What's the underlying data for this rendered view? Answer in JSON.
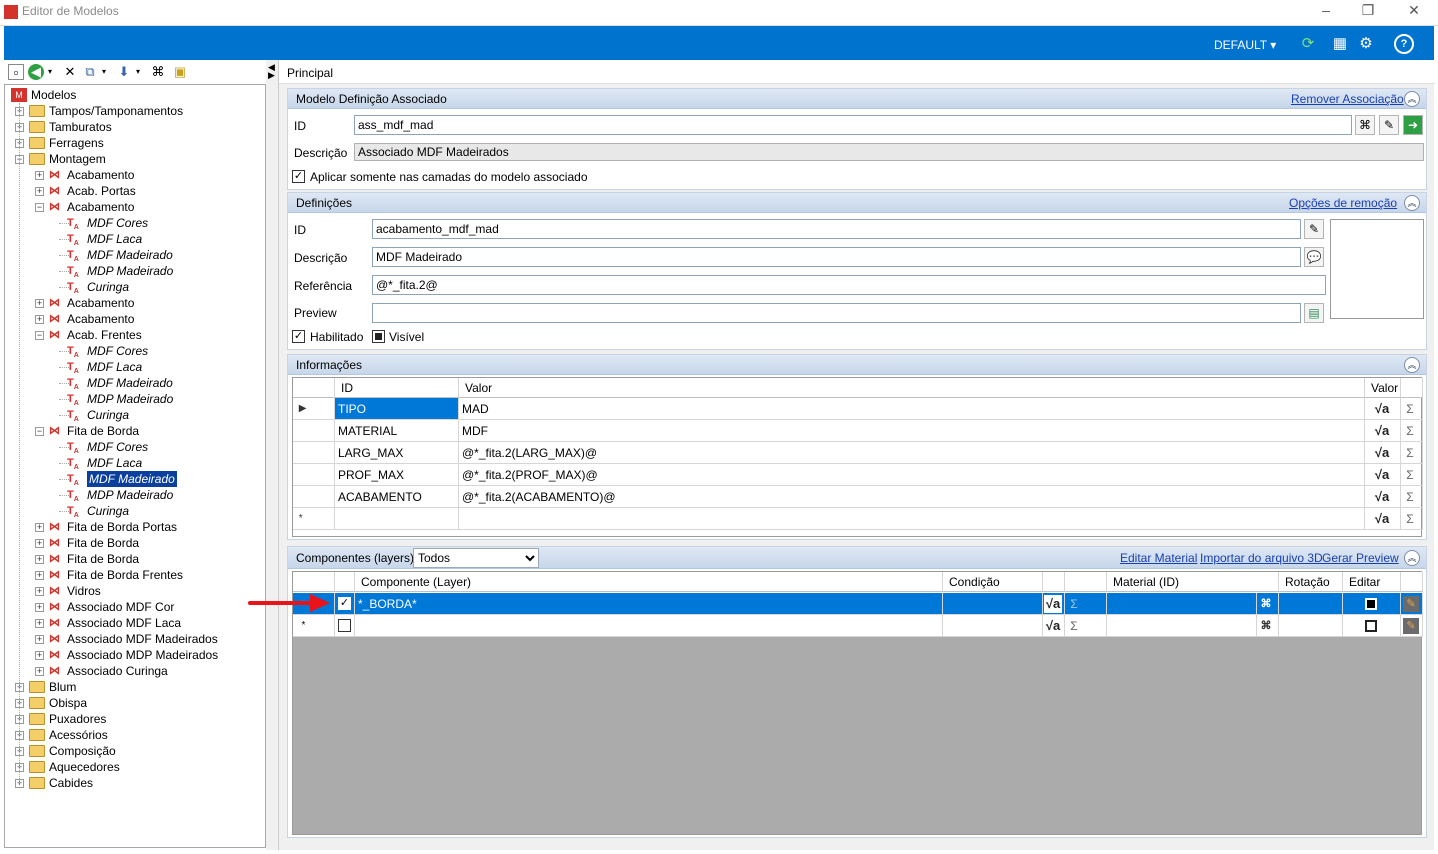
{
  "window": {
    "title": "Editor de Modelos"
  },
  "toolbar": {
    "profile": "DEFAULT"
  },
  "tree": {
    "root": "Modelos",
    "items": [
      {
        "label": "Tampos/Tamponamentos",
        "level": 1,
        "type": "folder",
        "exp": "+"
      },
      {
        "label": "Tamburatos",
        "level": 1,
        "type": "folder",
        "exp": "+"
      },
      {
        "label": "Ferragens",
        "level": 1,
        "type": "folder",
        "exp": "+"
      },
      {
        "label": "Montagem",
        "level": 1,
        "type": "folder",
        "exp": "-"
      },
      {
        "label": "Acabamento",
        "level": 2,
        "type": "model",
        "exp": "+"
      },
      {
        "label": "Acab. Portas",
        "level": 2,
        "type": "model",
        "exp": "+"
      },
      {
        "label": "Acabamento",
        "level": 2,
        "type": "model",
        "exp": "-"
      },
      {
        "label": "MDF Cores",
        "level": 3,
        "type": "leaf"
      },
      {
        "label": "MDF Laca",
        "level": 3,
        "type": "leaf"
      },
      {
        "label": "MDF Madeirado",
        "level": 3,
        "type": "leaf"
      },
      {
        "label": "MDP Madeirado",
        "level": 3,
        "type": "leaf"
      },
      {
        "label": "Curinga",
        "level": 3,
        "type": "leaf"
      },
      {
        "label": "Acabamento",
        "level": 2,
        "type": "model",
        "exp": "+"
      },
      {
        "label": "Acabamento",
        "level": 2,
        "type": "model",
        "exp": "+"
      },
      {
        "label": "Acab. Frentes",
        "level": 2,
        "type": "model",
        "exp": "-"
      },
      {
        "label": "MDF Cores",
        "level": 3,
        "type": "leaf"
      },
      {
        "label": "MDF Laca",
        "level": 3,
        "type": "leaf"
      },
      {
        "label": "MDF Madeirado",
        "level": 3,
        "type": "leaf"
      },
      {
        "label": "MDP Madeirado",
        "level": 3,
        "type": "leaf"
      },
      {
        "label": "Curinga",
        "level": 3,
        "type": "leaf"
      },
      {
        "label": "Fita de Borda",
        "level": 2,
        "type": "model",
        "exp": "-"
      },
      {
        "label": "MDF Cores",
        "level": 3,
        "type": "leaf"
      },
      {
        "label": "MDF Laca",
        "level": 3,
        "type": "leaf"
      },
      {
        "label": "MDF Madeirado",
        "level": 3,
        "type": "leaf",
        "selected": true
      },
      {
        "label": "MDP Madeirado",
        "level": 3,
        "type": "leaf"
      },
      {
        "label": "Curinga",
        "level": 3,
        "type": "leaf"
      },
      {
        "label": "Fita de Borda Portas",
        "level": 2,
        "type": "model",
        "exp": "+"
      },
      {
        "label": "Fita de Borda",
        "level": 2,
        "type": "model",
        "exp": "+"
      },
      {
        "label": "Fita de Borda",
        "level": 2,
        "type": "model",
        "exp": "+"
      },
      {
        "label": "Fita de Borda Frentes",
        "level": 2,
        "type": "model",
        "exp": "+"
      },
      {
        "label": "Vidros",
        "level": 2,
        "type": "model",
        "exp": "+"
      },
      {
        "label": "Associado MDF Cor",
        "level": 2,
        "type": "model",
        "exp": "+"
      },
      {
        "label": "Associado MDF Laca",
        "level": 2,
        "type": "model",
        "exp": "+"
      },
      {
        "label": "Associado MDF Madeirados",
        "level": 2,
        "type": "model",
        "exp": "+"
      },
      {
        "label": "Associado MDP Madeirados",
        "level": 2,
        "type": "model",
        "exp": "+"
      },
      {
        "label": "Associado Curinga",
        "level": 2,
        "type": "model",
        "exp": "+"
      },
      {
        "label": "Blum",
        "level": 1,
        "type": "folder",
        "exp": "+"
      },
      {
        "label": "Obispa",
        "level": 1,
        "type": "folder",
        "exp": "+"
      },
      {
        "label": "Puxadores",
        "level": 1,
        "type": "folder",
        "exp": "+"
      },
      {
        "label": "Acessórios",
        "level": 1,
        "type": "folder",
        "exp": "+"
      },
      {
        "label": "Composição",
        "level": 1,
        "type": "folder",
        "exp": "+"
      },
      {
        "label": "Aquecedores",
        "level": 1,
        "type": "folder",
        "exp": "+"
      },
      {
        "label": "Cabides",
        "level": 1,
        "type": "folder",
        "exp": "+"
      }
    ]
  },
  "main": {
    "tab": "Principal",
    "assoc": {
      "title": "Modelo Definição Associado",
      "link": "Remover Associação",
      "id_label": "ID",
      "id_value": "ass_mdf_mad",
      "desc_label": "Descrição",
      "desc_value": "Associado MDF Madeirados",
      "check_label": "Aplicar somente nas camadas do modelo associado"
    },
    "defs": {
      "title": "Definições",
      "link": "Opções de remoção",
      "id_label": "ID",
      "id_value": "acabamento_mdf_mad",
      "desc_label": "Descrição",
      "desc_value": "MDF Madeirado",
      "ref_label": "Referência",
      "ref_value": "@*_fita.2@",
      "preview_label": "Preview",
      "preview_value": "",
      "enabled_label": "Habilitado",
      "visible_label": "Visível"
    },
    "info": {
      "title": "Informações",
      "col_id": "ID",
      "col_valor": "Valor",
      "col_valor2": "Valor",
      "rows": [
        {
          "id": "TIPO",
          "valor": "MAD"
        },
        {
          "id": "MATERIAL",
          "valor": "MDF"
        },
        {
          "id": "LARG_MAX",
          "valor": "@*_fita.2(LARG_MAX)@"
        },
        {
          "id": "PROF_MAX",
          "valor": "@*_fita.2(PROF_MAX)@"
        },
        {
          "id": "ACABAMENTO",
          "valor": "@*_fita.2(ACABAMENTO)@"
        }
      ]
    },
    "comps": {
      "title": "Componentes (layers)",
      "filter": "Todos",
      "link_edit": "Editar Material",
      "link_import": "Importar do arquivo 3D",
      "link_preview": "Gerar Preview",
      "col_comp": "Componente (Layer)",
      "col_cond": "Condição",
      "col_mat": "Material (ID)",
      "col_rot": "Rotação",
      "col_edit": "Editar",
      "rows": [
        {
          "comp": "*_BORDA*",
          "checked": true
        }
      ]
    }
  }
}
